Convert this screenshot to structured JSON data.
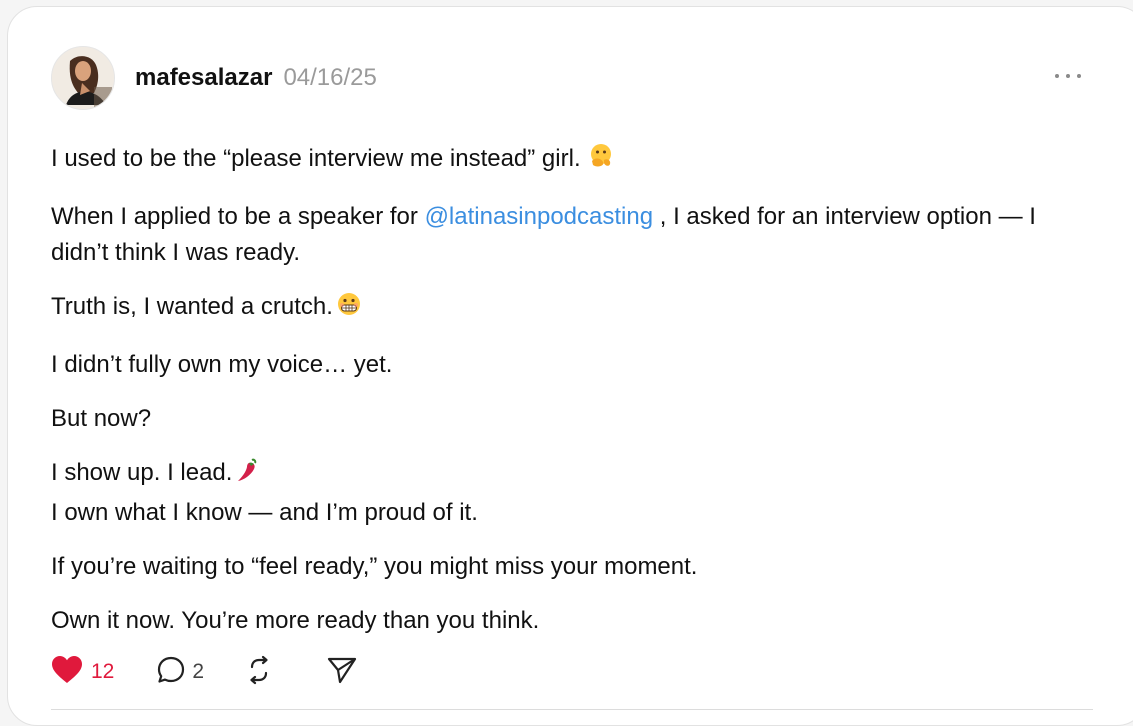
{
  "post": {
    "username": "mafesalazar",
    "date": "04/16/25",
    "paragraphs": {
      "p1": "I used to be the “please interview me instead” girl.",
      "p2_before": "When I applied to be a speaker for ",
      "p2_mention": "@latinasinpodcasting",
      "p2_after": " , I asked for an interview option — I didn’t think I was ready.",
      "p3": "Truth is, I wanted a crutch.",
      "p4": "I didn’t fully own my voice… yet.",
      "p5": "But now?",
      "p6_line1": "I show up. I lead.",
      "p6_line2": "I own what I know — and I’m proud of it.",
      "p7": "If you’re waiting to “feel ready,” you might miss your moment.",
      "p8": "Own it now. You’re more ready than you think."
    },
    "emojis": {
      "p1": "hand-over-mouth-emoji",
      "p3": "grimacing-face-emoji",
      "p6": "hot-pepper-emoji"
    }
  },
  "actions": {
    "likes": "12",
    "comments": "2",
    "like_color": "#e0193c"
  },
  "colors": {
    "mention": "#3b8ee0",
    "meta": "#9a9a9a"
  }
}
